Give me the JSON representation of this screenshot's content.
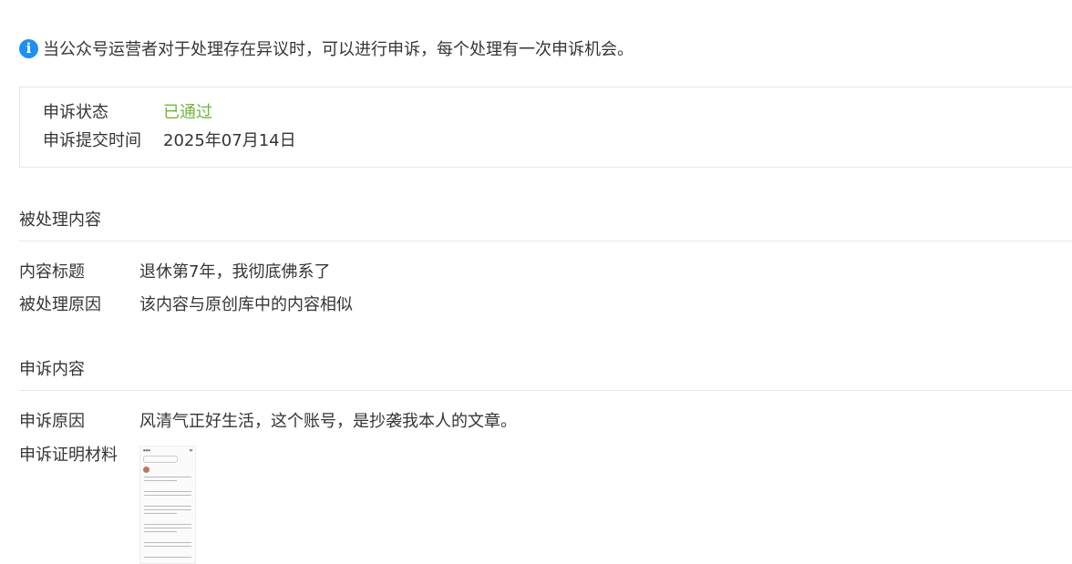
{
  "notice": {
    "icon": "info-icon",
    "text": "当公众号运营者对于处理存在异议时，可以进行申诉，每个处理有一次申诉机会。"
  },
  "appeal_status": {
    "status_label": "申诉状态",
    "status_value": "已通过",
    "status_color": "#6fb53c",
    "submit_time_label": "申诉提交时间",
    "submit_time_value": "2025年07月14日"
  },
  "processed_content": {
    "section_title": "被处理内容",
    "title_label": "内容标题",
    "title_value": "退休第7年，我彻底佛系了",
    "reason_label": "被处理原因",
    "reason_value": "该内容与原创库中的内容相似"
  },
  "appeal_content": {
    "section_title": "申诉内容",
    "reason_label": "申诉原因",
    "reason_value": "风清气正好生活，这个账号，是抄袭我本人的文章。",
    "evidence_label": "申诉证明材料"
  },
  "colors": {
    "accent": "#1e8ff3",
    "divider": "#e7e7eb",
    "text": "#353535"
  }
}
